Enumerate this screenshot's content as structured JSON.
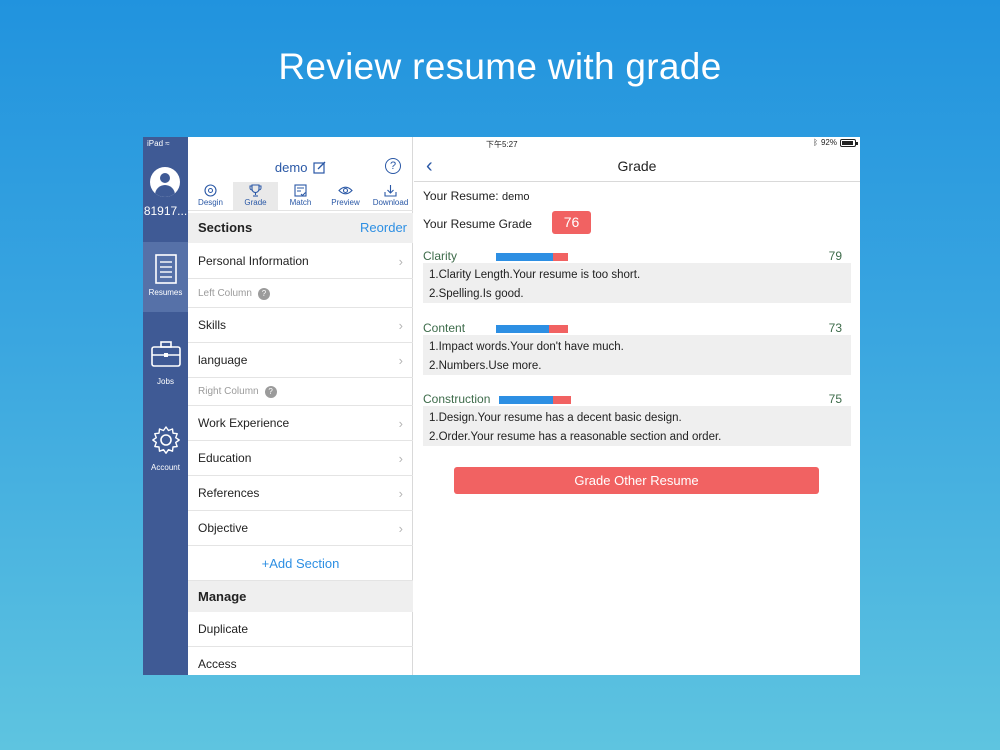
{
  "headline": "Review resume with grade",
  "status": {
    "carrier": "iPad",
    "time": "下午5:27",
    "battery": "92%"
  },
  "rail": {
    "user_id": "81917...",
    "items": [
      {
        "label": "Resumes",
        "icon": "resume-icon",
        "active": true
      },
      {
        "label": "Jobs",
        "icon": "briefcase-icon",
        "active": false
      },
      {
        "label": "Account",
        "icon": "gear-icon",
        "active": false
      }
    ]
  },
  "editor": {
    "doc_name": "demo",
    "toolbar": [
      {
        "label": "Desgin",
        "icon": "design-icon"
      },
      {
        "label": "Grade",
        "icon": "trophy-icon",
        "active": true
      },
      {
        "label": "Match",
        "icon": "match-icon"
      },
      {
        "label": "Preview",
        "icon": "eye-icon"
      },
      {
        "label": "Download",
        "icon": "download-icon"
      }
    ],
    "sections_title": "Sections",
    "reorder_label": "Reorder",
    "personal_info": "Personal Information",
    "left_column": "Left Column",
    "skills": "Skills",
    "language": "language",
    "right_column": "Right Column",
    "work_experience": "Work Experience",
    "education": "Education",
    "references": "References",
    "objective": "Objective",
    "add_section": "+Add Section",
    "manage_title": "Manage",
    "duplicate": "Duplicate",
    "access": "Access"
  },
  "grade": {
    "nav_title": "Grade",
    "your_resume_label": "Your Resume:",
    "your_resume_name": "demo",
    "your_grade_label": "Your Resume Grade",
    "grade_value": "76",
    "categories": [
      {
        "name": "Clarity",
        "score": "79",
        "bar_fraction": 0.79,
        "lines": [
          "1.Clarity Length.Your resume is too short.",
          "2.Spelling.Is good."
        ]
      },
      {
        "name": "Content",
        "score": "73",
        "bar_fraction": 0.73,
        "lines": [
          "1.Impact words.Your don't have much.",
          "2.Numbers.Use more."
        ]
      },
      {
        "name": "Construction",
        "score": "75",
        "bar_fraction": 0.75,
        "lines": [
          "1.Design.Your resume has a decent basic design.",
          "2.Order.Your resume has a reasonable section and order."
        ]
      }
    ],
    "grade_other_label": "Grade Other Resume"
  },
  "colors": {
    "accent_blue": "#2a58a6",
    "rail_bg": "#3f5a95",
    "badge_red": "#f16262",
    "bar_blue": "#2d8fe3"
  }
}
